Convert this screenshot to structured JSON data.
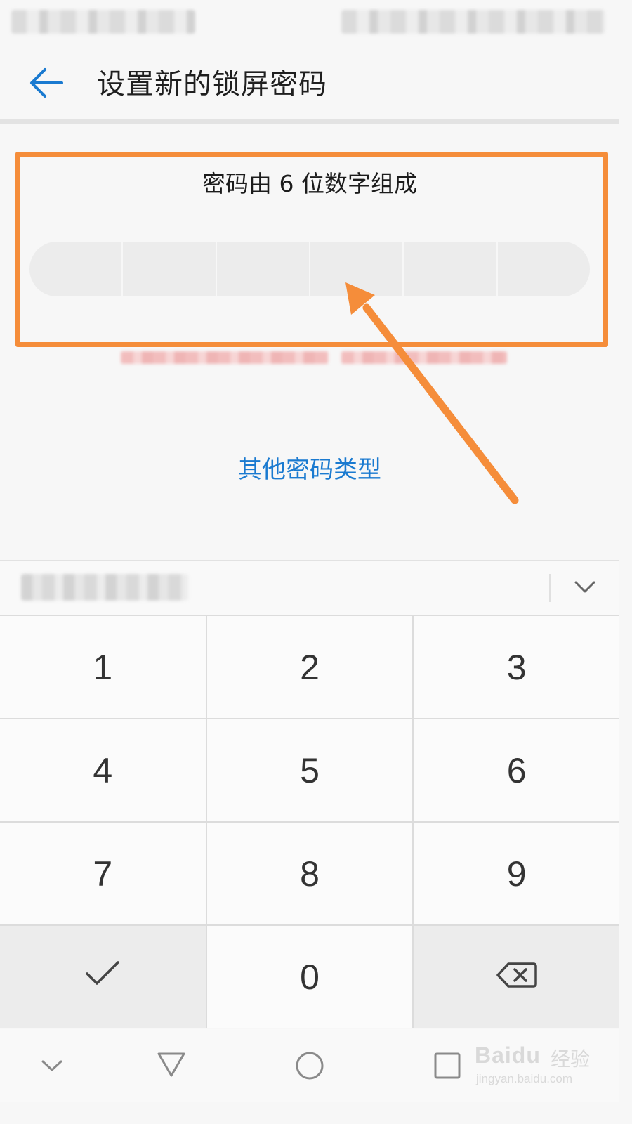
{
  "header": {
    "title": "设置新的锁屏密码"
  },
  "main": {
    "hint": "密码由 6 位数字组成",
    "pin_length": 6,
    "other_types_link": "其他密码类型"
  },
  "keyboard": {
    "keys": [
      {
        "label": "1",
        "name": "key-1"
      },
      {
        "label": "2",
        "name": "key-2"
      },
      {
        "label": "3",
        "name": "key-3"
      },
      {
        "label": "4",
        "name": "key-4"
      },
      {
        "label": "5",
        "name": "key-5"
      },
      {
        "label": "6",
        "name": "key-6"
      },
      {
        "label": "7",
        "name": "key-7"
      },
      {
        "label": "8",
        "name": "key-8"
      },
      {
        "label": "9",
        "name": "key-9"
      },
      {
        "label": "",
        "name": "confirm-key",
        "icon": "checkmark-icon"
      },
      {
        "label": "0",
        "name": "key-0"
      },
      {
        "label": "",
        "name": "backspace-key",
        "icon": "backspace-icon"
      }
    ]
  },
  "navbar": {
    "icons": [
      "chevron-down-icon",
      "back-triangle-icon",
      "home-circle-icon",
      "recents-square-icon"
    ]
  },
  "watermark": {
    "brand": "Baidu",
    "brand_suffix": "经验",
    "url": "jingyan.baidu.com"
  },
  "colors": {
    "accent": "#1a7ad0",
    "annotation": "#f58d3a"
  }
}
